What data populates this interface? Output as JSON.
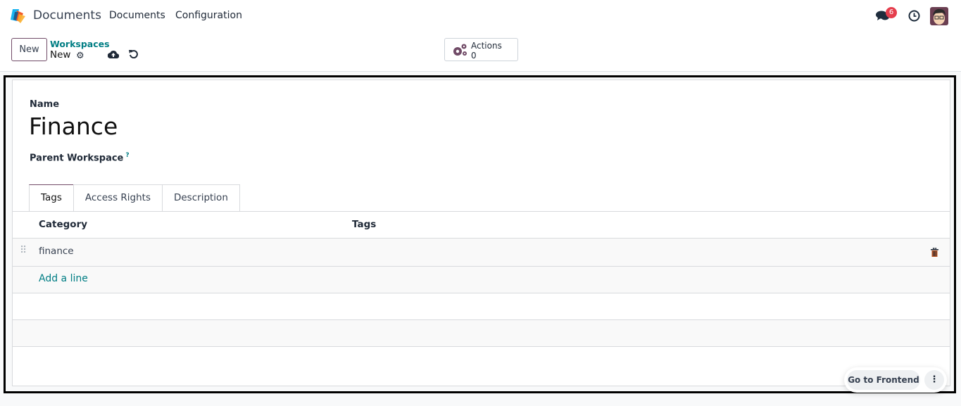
{
  "topnav": {
    "app_name": "Documents",
    "menu": [
      "Documents",
      "Configuration"
    ],
    "chat_badge": "6"
  },
  "control_panel": {
    "new_label": "New",
    "breadcrumb_parent": "Workspaces",
    "breadcrumb_current": "New",
    "actions_label": "Actions",
    "actions_count": "0"
  },
  "form": {
    "name_label": "Name",
    "name_value": "Finance",
    "parent_label": "Parent Workspace",
    "parent_help": "?",
    "tabs": [
      "Tags",
      "Access Rights",
      "Description"
    ],
    "active_tab": "Tags",
    "table": {
      "columns": [
        "Category",
        "Tags"
      ],
      "rows": [
        {
          "category": "finance",
          "tags": ""
        }
      ],
      "add_line": "Add a line"
    }
  },
  "footer": {
    "go_frontend": "Go to Frontend"
  },
  "colors": {
    "brand": "#714b67",
    "link": "#017e84",
    "badge": "#e53e4d",
    "trash": "#c05621"
  }
}
